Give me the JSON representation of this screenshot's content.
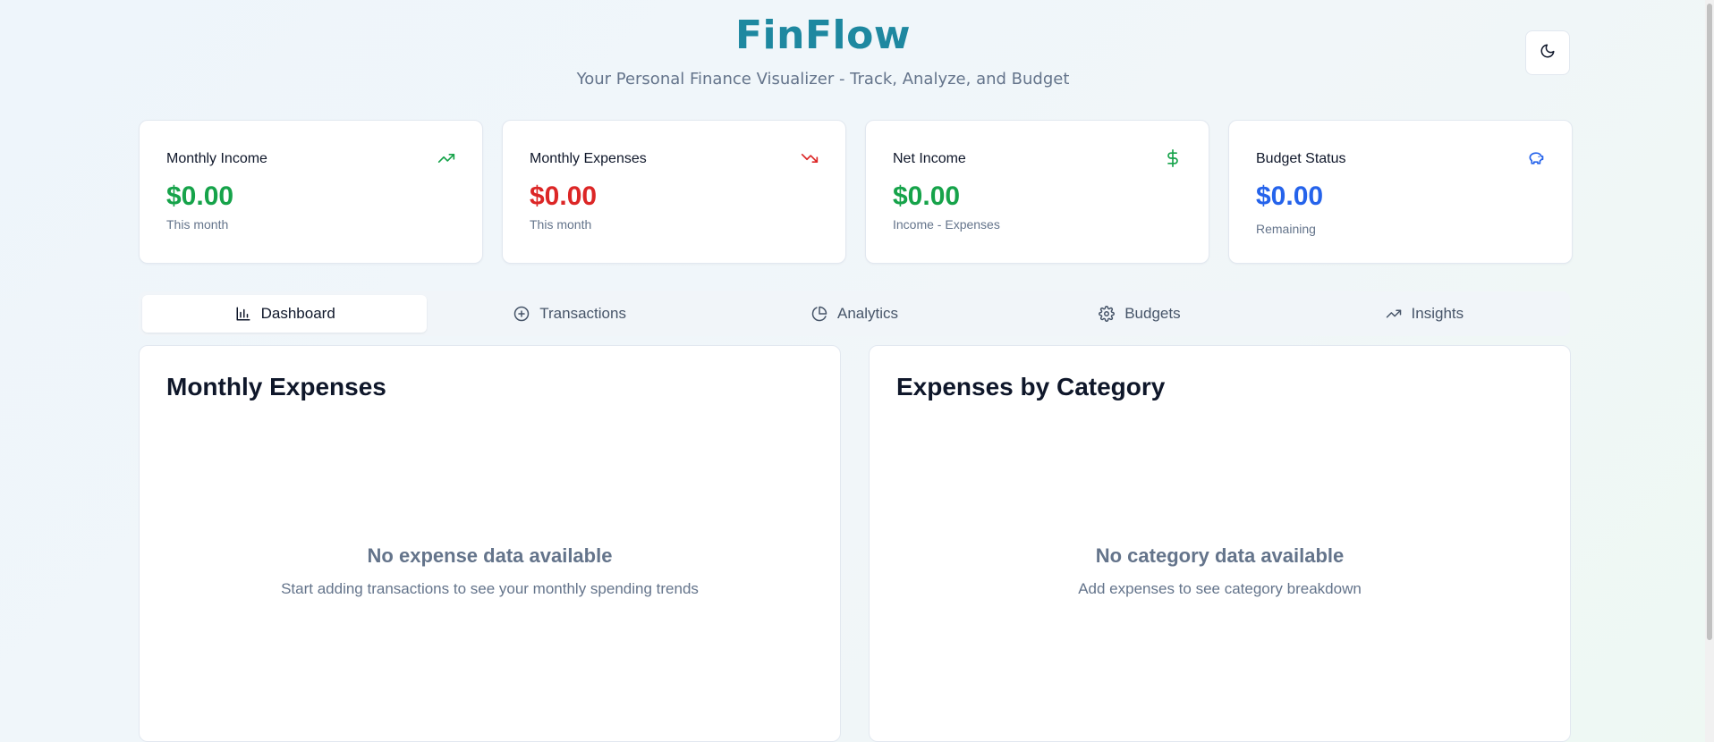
{
  "header": {
    "title": "FinFlow",
    "subtitle": "Your Personal Finance Visualizer - Track, Analyze, and Budget",
    "theme_toggle_icon": "moon-icon"
  },
  "stats": [
    {
      "label": "Monthly Income",
      "value": "$0.00",
      "caption": "This month",
      "icon": "trending-up-icon",
      "color": "#16a34a"
    },
    {
      "label": "Monthly Expenses",
      "value": "$0.00",
      "caption": "This month",
      "icon": "trending-down-icon",
      "color": "#dc2626"
    },
    {
      "label": "Net Income",
      "value": "$0.00",
      "caption": "Income - Expenses",
      "icon": "dollar-icon",
      "color": "#16a34a"
    },
    {
      "label": "Budget Status",
      "value": "$0.00",
      "caption": "Remaining",
      "icon": "piggy-bank-icon",
      "color": "#2563eb"
    }
  ],
  "tabs": [
    {
      "label": "Dashboard",
      "icon": "bar-chart-icon",
      "active": true
    },
    {
      "label": "Transactions",
      "icon": "plus-circle-icon",
      "active": false
    },
    {
      "label": "Analytics",
      "icon": "pie-chart-icon",
      "active": false
    },
    {
      "label": "Budgets",
      "icon": "gear-icon",
      "active": false
    },
    {
      "label": "Insights",
      "icon": "trending-up-icon",
      "active": false
    }
  ],
  "panels": [
    {
      "title": "Monthly Expenses",
      "empty_title": "No expense data available",
      "empty_desc": "Start adding transactions to see your monthly spending trends"
    },
    {
      "title": "Expenses by Category",
      "empty_title": "No category data available",
      "empty_desc": "Add expenses to see category breakdown"
    }
  ],
  "colors": {
    "brand": "#1e88a0",
    "income": "#16a34a",
    "expense": "#dc2626",
    "budget": "#2563eb",
    "muted": "#64748b"
  }
}
